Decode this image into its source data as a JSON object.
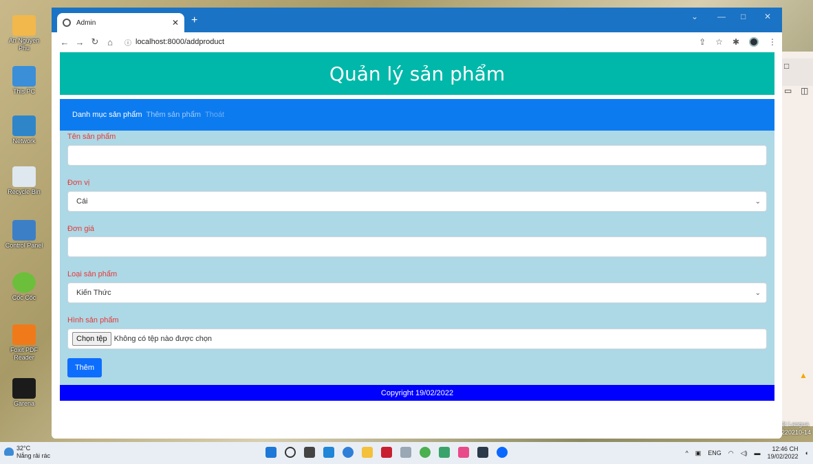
{
  "desktop": {
    "icons": [
      {
        "label": "An Nguyen Phu"
      },
      {
        "label": "This PC"
      },
      {
        "label": "Network"
      },
      {
        "label": "Recycle Bin"
      },
      {
        "label": "Control Panel"
      },
      {
        "label": "Cốc Cốc"
      },
      {
        "label": "Foxit PDF Reader"
      },
      {
        "label": "Garena"
      }
    ],
    "right_window_text": [
      "ệt Langua",
      "220210-14"
    ]
  },
  "browser": {
    "tab_title": "Admin",
    "new_tab": "+",
    "url": "localhost:8000/addproduct"
  },
  "page": {
    "header_title": "Quản lý sản phẩm",
    "nav": [
      "Danh mục sản phẩm",
      "Thêm sản phẩm",
      "Thoát"
    ],
    "form": {
      "name_label": "Tên sản phẩm",
      "name_value": "",
      "unit_label": "Đơn vị",
      "unit_selected": "Cái",
      "price_label": "Đơn giá",
      "price_value": "",
      "type_label": "Loại sản phẩm",
      "type_selected": "Kiến Thức",
      "image_label": "Hình sản phẩm",
      "file_button": "Chọn tệp",
      "file_status": "Không có tệp nào được chọn",
      "submit_label": "Thêm"
    },
    "footer": "Copyright 19/02/2022"
  },
  "taskbar": {
    "temperature": "32°C",
    "weather": "Nắng rải rác",
    "language": "ENG",
    "time": "12:46 CH",
    "date": "19/02/2022"
  },
  "colors": {
    "header_bg": "#00b8a9",
    "nav_bg": "#0d7bf0",
    "form_bg": "#add8e6",
    "label_red": "#e53935",
    "button_blue": "#0d6efd",
    "footer_bg": "#0000ff"
  }
}
